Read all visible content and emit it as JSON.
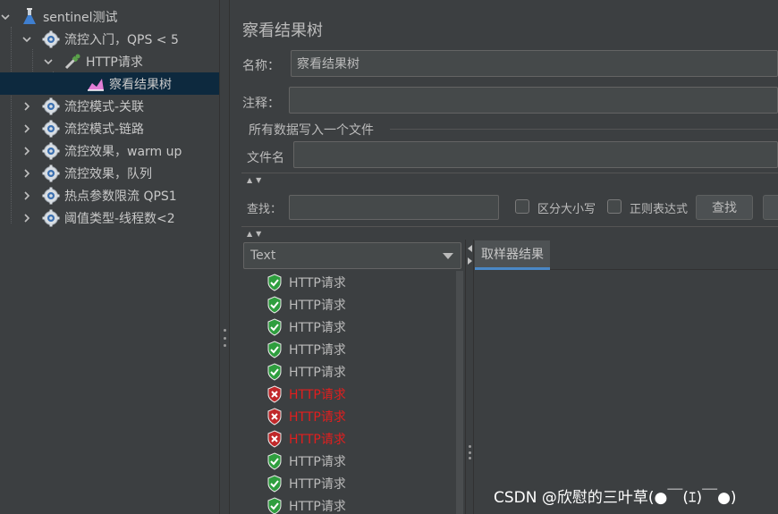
{
  "tree": {
    "items": [
      {
        "label": "sentinel测试"
      },
      {
        "label": "流控入门，QPS < 5"
      },
      {
        "label": "HTTP请求"
      },
      {
        "label": "察看结果树"
      },
      {
        "label": "流控模式-关联"
      },
      {
        "label": "流控模式-链路"
      },
      {
        "label": "流控效果，warm up"
      },
      {
        "label": "流控效果，队列"
      },
      {
        "label": "热点参数限流 QPS1"
      },
      {
        "label": "阈值类型-线程数<2"
      }
    ]
  },
  "panel": {
    "title": "察看结果树",
    "name_label": "名称：",
    "name_value": "察看结果树",
    "comment_label": "注释：",
    "comment_value": "",
    "file_group_title": "所有数据写入一个文件",
    "filename_label": "文件名",
    "filename_value": ""
  },
  "search": {
    "label": "查找：",
    "value": "",
    "case_label": "区分大小写",
    "regex_label": "正则表达式",
    "find_button": "查找",
    "case_checked": false,
    "regex_checked": false
  },
  "renderer": {
    "selected": "Text"
  },
  "results": [
    {
      "label": "HTTP请求",
      "status": "success"
    },
    {
      "label": "HTTP请求",
      "status": "success"
    },
    {
      "label": "HTTP请求",
      "status": "success"
    },
    {
      "label": "HTTP请求",
      "status": "success"
    },
    {
      "label": "HTTP请求",
      "status": "success"
    },
    {
      "label": "HTTP请求",
      "status": "error"
    },
    {
      "label": "HTTP请求",
      "status": "error"
    },
    {
      "label": "HTTP请求",
      "status": "error"
    },
    {
      "label": "HTTP请求",
      "status": "success"
    },
    {
      "label": "HTTP请求",
      "status": "success"
    },
    {
      "label": "HTTP请求",
      "status": "success"
    }
  ],
  "result_tabs": [
    {
      "label": "取样器结果"
    }
  ],
  "watermark": "CSDN @欣慰的三叶草(●￣(ｴ)￣●)",
  "colors": {
    "background": "#3c3f41",
    "selection": "#0d293e",
    "error_text": "#e21e1e",
    "success_icon": "#2e9e3e",
    "error_icon": "#c0282a",
    "tab_accent": "#4a88c7"
  }
}
